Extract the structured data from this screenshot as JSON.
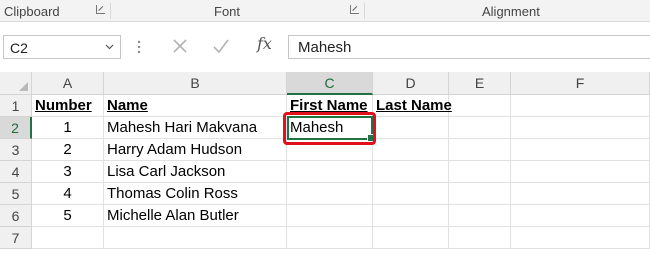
{
  "ribbon": {
    "groups": [
      {
        "label": "Clipboard"
      },
      {
        "label": "Font"
      },
      {
        "label": "Alignment"
      }
    ]
  },
  "formula_bar": {
    "name_box": "C2",
    "fx_label": "fx",
    "formula_value": "Mahesh",
    "icons": [
      "more-options-icon",
      "cancel-icon",
      "enter-icon",
      "insert-function-icon"
    ]
  },
  "grid": {
    "columns": [
      "A",
      "B",
      "C",
      "D",
      "E",
      "F"
    ],
    "rows": [
      "1",
      "2",
      "3",
      "4",
      "5",
      "6",
      "7"
    ],
    "selected_cell": "C2",
    "cells": {
      "A1": "Number",
      "B1": "Name",
      "C1": "First Name",
      "D1": "Last Name",
      "A2": "1",
      "B2": "Mahesh Hari Makvana",
      "C2": "Mahesh",
      "A3": "2",
      "B3": "Harry Adam Hudson",
      "A4": "3",
      "B4": "Lisa Carl Jackson",
      "A5": "4",
      "B5": "Thomas Colin Ross",
      "A6": "5",
      "B6": "Michelle Alan Butler"
    }
  },
  "colors": {
    "excel_green": "#217346",
    "highlight_red": "#e0111d",
    "header_bg": "#f0f0f0"
  }
}
